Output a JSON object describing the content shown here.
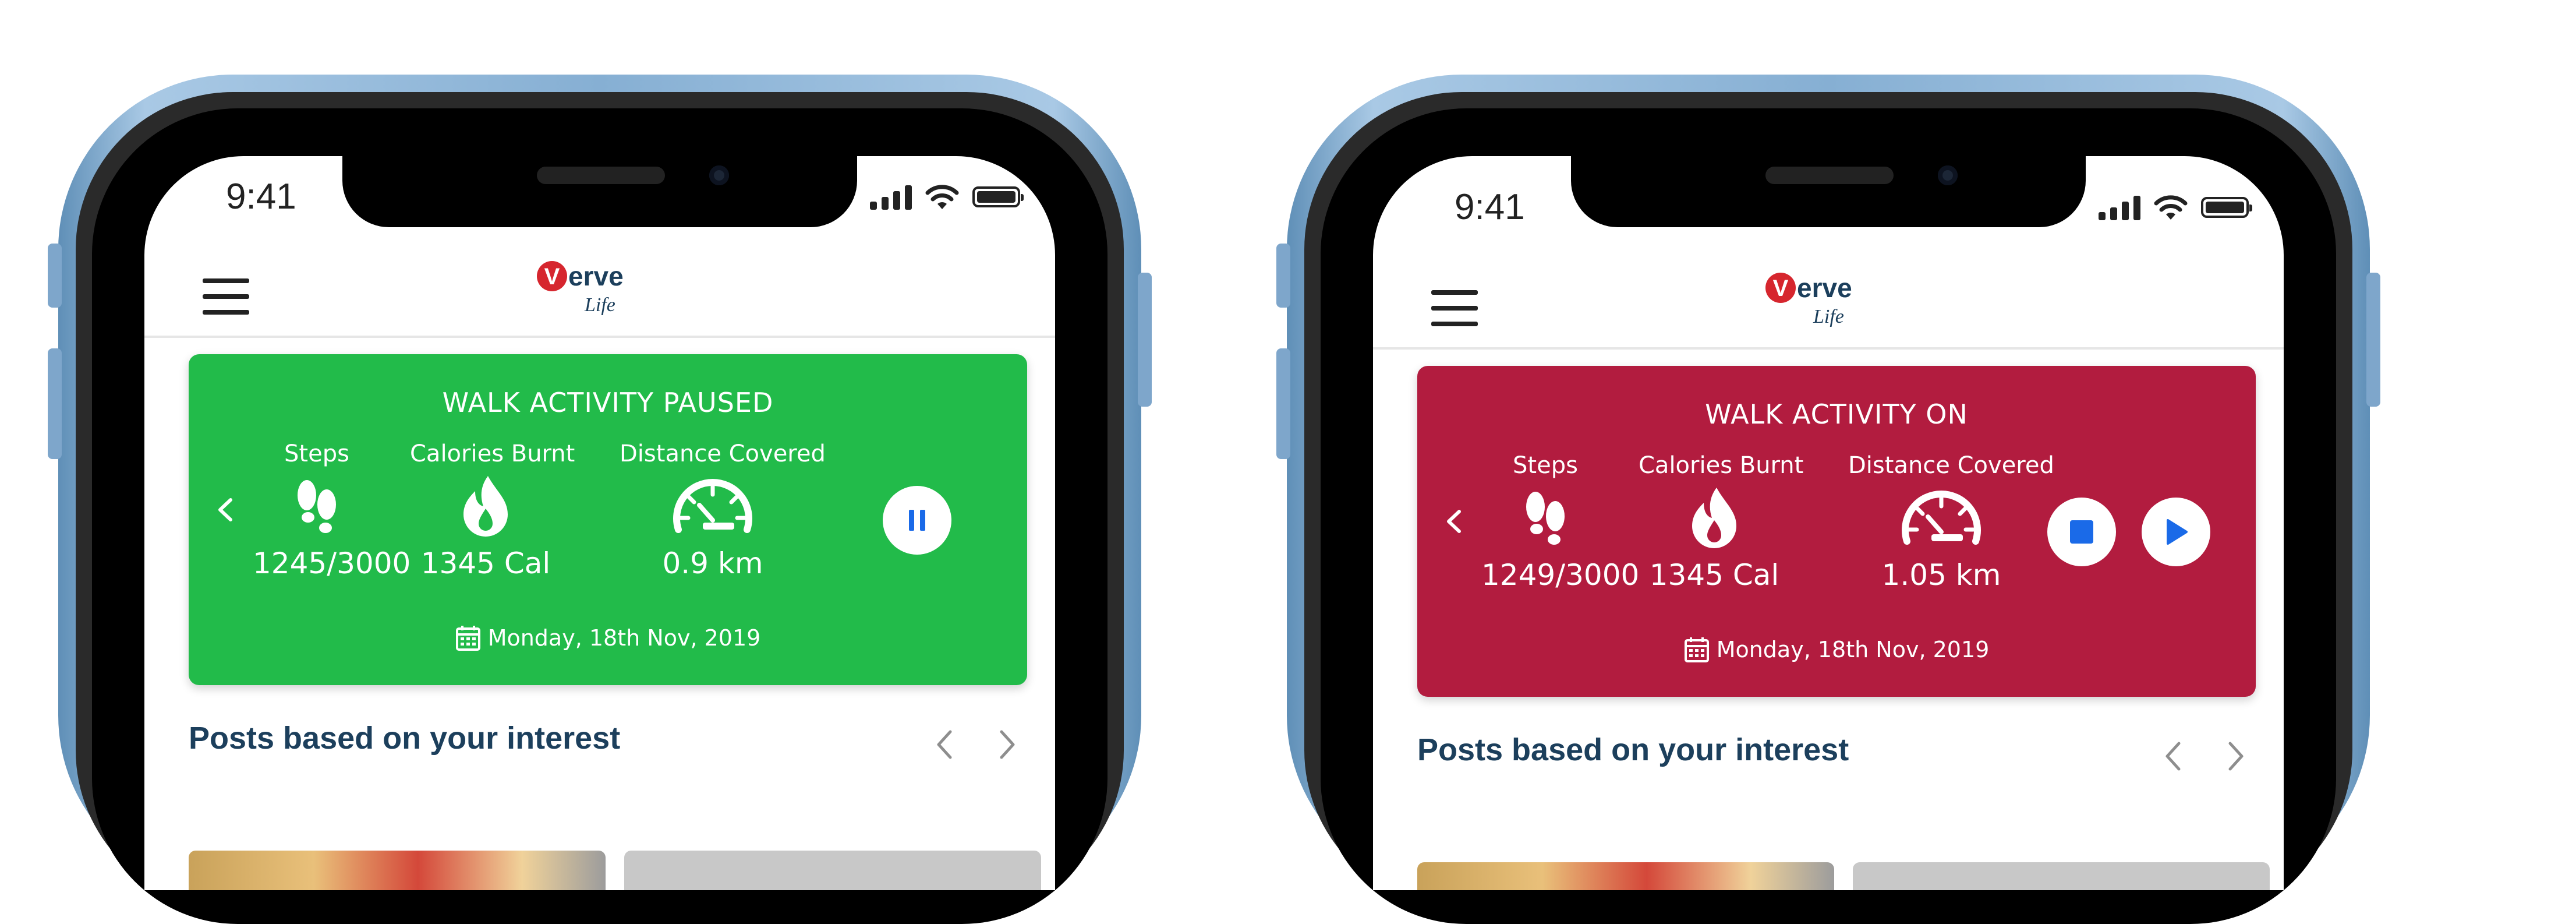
{
  "screens": [
    {
      "status_time": "9:41",
      "card": {
        "title": "WALK ACTIVITY PAUSED",
        "bg_color": "#22bb4a",
        "steps_label": "Steps",
        "steps_value": "1245/3000",
        "calories_label": "Calories Burnt",
        "calories_value": "1345 Cal",
        "distance_label": "Distance Covered",
        "distance_value": "0.9 km",
        "date": "Monday, 18th Nov, 2019",
        "controls": [
          "pause"
        ]
      },
      "posts_title": "Posts based on your interest"
    },
    {
      "status_time": "9:41",
      "card": {
        "title": "WALK ACTIVITY ON",
        "bg_color": "#b21c3f",
        "steps_label": "Steps",
        "steps_value": "1249/3000",
        "calories_label": "Calories Burnt",
        "calories_value": "1345 Cal",
        "distance_label": "Distance Covered",
        "distance_value": "1.05 km",
        "date": "Monday, 18th Nov, 2019",
        "controls": [
          "stop",
          "play"
        ]
      },
      "posts_title": "Posts based on your interest"
    }
  ],
  "logo": {
    "primary": "erve",
    "initial": "V",
    "script": "Life",
    "accent_color": "#d6262e",
    "text_color": "#1c3f5c"
  },
  "colors": {
    "accent_blue": "#1a6ae8",
    "heading": "#1c3f5c"
  }
}
